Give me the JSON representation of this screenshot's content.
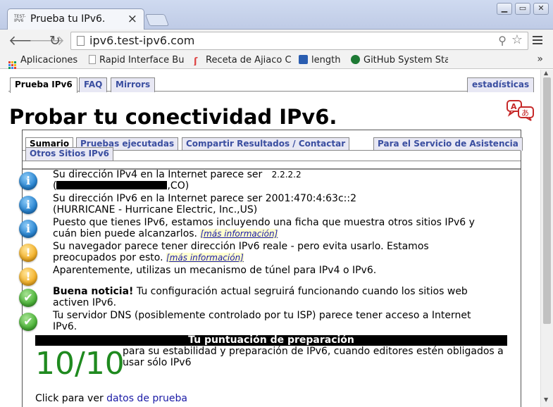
{
  "browser": {
    "tab": {
      "title": "Prueba tu IPv6.",
      "favicon_text": "TEST-IPV6"
    },
    "address_bar": {
      "url": "ipv6.test-ipv6.com"
    },
    "bookmarks": [
      {
        "label": "Aplicaciones"
      },
      {
        "label": "Rapid Interface Bu"
      },
      {
        "label": "Receta de Ajiaco C"
      },
      {
        "label": "length"
      },
      {
        "label": "GitHub System Sta"
      }
    ],
    "bookmarks_overflow": "»"
  },
  "site_nav": {
    "tabs": [
      {
        "label": "Prueba IPv6"
      },
      {
        "label": "FAQ"
      },
      {
        "label": "Mirrors"
      }
    ],
    "right_tab": "estadísticas"
  },
  "page": {
    "title": "Probar tu conectividad IPv6."
  },
  "subtabs": [
    {
      "label": "Sumario"
    },
    {
      "label": "Pruebas ejecutadas"
    },
    {
      "label": "Compartir Resultados / Contactar"
    },
    {
      "label": "Para el Servicio de Asistencia"
    },
    {
      "label": "Otros Sitios IPv6"
    }
  ],
  "results": [
    {
      "icon": "info",
      "line1_text": "Su dirección IPv4 en la Internet parece ser",
      "ip": "2.2.2.2",
      "line2_prefix": "(",
      "line2_suffix": ",CO)"
    },
    {
      "icon": "info",
      "line1": "Su dirección IPv6 en la Internet parece ser 2001:470:4:63c::2",
      "line2": "(HURRICANE - Hurricane Electric, Inc.,US)"
    },
    {
      "icon": "info",
      "text": "Puesto que tienes IPv6, estamos incluyendo una ficha que muestra otros sitios IPv6 y cuán bien puede alcanzarlos.",
      "link": "[más información]"
    },
    {
      "icon": "warn",
      "text": "Su navegador parece tener dirección IPv6 reale - pero evita usarlo. Estamos preocupados por esto.",
      "link": "[más información]"
    },
    {
      "icon": "warn",
      "text": "Aparentemente, utilizas un mecanismo de túnel para IPv4 o IPv6."
    },
    {
      "icon": "ok",
      "bold": "Buena noticia!",
      "text": " Tu configuración actual segruirá funcionando cuando los sitios web activen IPv6."
    },
    {
      "icon": "ok",
      "text": "Tu servidor DNS (posiblemente controlado por tu ISP) parece tener acceso a Internet IPv6."
    }
  ],
  "score": {
    "header": "Tu puntuación de preparación",
    "value": "10/10",
    "description": "para su estabilidad y preparación de IPv6, cuando editores estén obligados a usar sólo IPv6"
  },
  "footer": {
    "prefix": "Click para ver",
    "link": "datos de prueba"
  },
  "colors": {
    "link": "#1a1aa6",
    "score": "#1f8a1f",
    "tab_text": "#3a4ea0"
  }
}
